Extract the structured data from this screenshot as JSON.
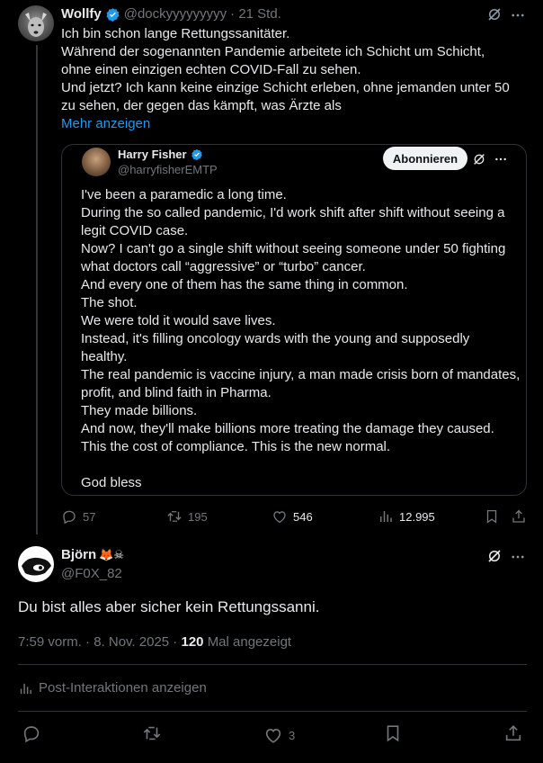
{
  "quoted_tweet": {
    "author_name": "Wollfy",
    "handle": "@dockyyyyyyyyy",
    "time": "· 21 Std.",
    "lines": [
      "Ich bin schon lange Rettungssanitäter.",
      "Während der sogenannten Pandemie arbeitete ich Schicht um Schicht,",
      "ohne einen einzigen echten COVID-Fall zu sehen.",
      "Und jetzt? Ich kann keine einzige Schicht erleben, ohne jemanden unter 50",
      "zu sehen, der gegen das kämpft, was Ärzte als"
    ],
    "show_more": "Mehr anzeigen",
    "embed": {
      "author_name": "Harry Fisher",
      "handle": "@harryfisherEMTP",
      "follow_label": "Abonnieren",
      "lines": [
        "I've been a paramedic a long time.",
        "During the so called pandemic, I'd work shift after shift without seeing a",
        "legit COVID case.",
        "Now? I can't go a single shift without seeing someone under 50 fighting",
        "what doctors call “aggressive” or “turbo” cancer.",
        "And every one of them has the same thing in common.",
        "The shot.",
        "We were told it would save lives.",
        "Instead, it's filling oncology wards with the young and supposedly",
        "healthy.",
        "The real pandemic is vaccine injury, a man made crisis born of mandates,",
        "profit, and blind faith in Pharma.",
        "They made billions.",
        "And now, they'll make billions more treating the damage they caused.",
        "This the cost of compliance. This is the new normal.",
        "",
        "God bless"
      ]
    },
    "stats": {
      "replies": "57",
      "reposts": "195",
      "likes": "546",
      "views": "12.995"
    }
  },
  "reply": {
    "author_name": "Björn",
    "author_emoji": "🦊☠",
    "handle": "@F0X_82",
    "text": "Du bist alles aber sicher kein Rettungssanni.",
    "timestamp": "7:59 vorm. · 8. Nov. 2025 ·",
    "view_count": "120",
    "view_label": "Mal angezeigt",
    "post_interactions": "Post-Interaktionen anzeigen",
    "likes": "3"
  },
  "colors": {
    "background": "#000000",
    "text": "#e7e9ea",
    "muted": "#71767b",
    "link": "#1d9bf0",
    "verified": "#1d9bf0",
    "divider": "#2f3336"
  },
  "icons": [
    "verified-icon",
    "grok-icon",
    "more-icon",
    "reply-icon",
    "repost-icon",
    "like-icon",
    "views-icon",
    "bookmark-icon",
    "share-icon"
  ]
}
